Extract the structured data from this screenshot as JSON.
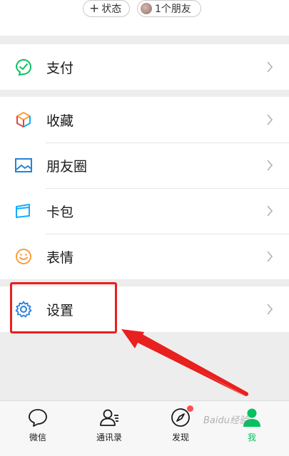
{
  "profile": {
    "status_label": "状态",
    "friends_label": "1个朋友"
  },
  "menu": {
    "pay": "支付",
    "favorites": "收藏",
    "moments": "朋友圈",
    "cards": "卡包",
    "stickers": "表情",
    "settings": "设置"
  },
  "tabbar": {
    "chats": "微信",
    "contacts": "通讯录",
    "discover": "发现",
    "me": "我"
  },
  "watermark": "Baidu经验",
  "colors": {
    "accent_green": "#07c160",
    "highlight_red": "#e8201e",
    "badge_red": "#fa5151"
  }
}
